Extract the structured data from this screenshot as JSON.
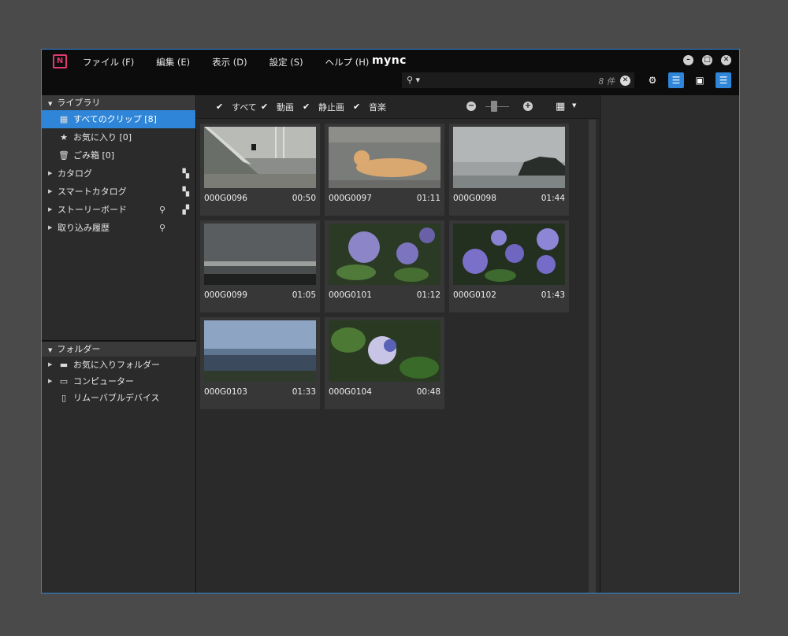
{
  "app": {
    "logo_text": "N",
    "brand": "mync",
    "menu": [
      "ファイル (F)",
      "編集 (E)",
      "表示 (D)",
      "設定 (S)",
      "ヘルプ (H)"
    ]
  },
  "search": {
    "count": "8 件",
    "value": ""
  },
  "library": {
    "header": "ライブラリ",
    "items": [
      {
        "label": "すべてのクリップ [8]",
        "icon": "clips-icon",
        "selected": true
      },
      {
        "label": "お気に入り [0]",
        "icon": "star-icon"
      },
      {
        "label": "ごみ箱 [0]",
        "icon": "trash-icon"
      }
    ],
    "groups": [
      {
        "label": "カタログ"
      },
      {
        "label": "スマートカタログ"
      },
      {
        "label": "ストーリーボード"
      },
      {
        "label": "取り込み履歴"
      }
    ]
  },
  "folders": {
    "header": "フォルダー",
    "items": [
      {
        "label": "お気に入りフォルダー",
        "icon": "folder-icon"
      },
      {
        "label": "コンピューター",
        "icon": "computer-icon"
      },
      {
        "label": "リムーバブルデバイス",
        "icon": "removable-device-icon"
      }
    ]
  },
  "filters": [
    "すべて",
    "動画",
    "静止画",
    "音楽"
  ],
  "clips": [
    {
      "name": "000G0096",
      "duration": "00:50"
    },
    {
      "name": "000G0097",
      "duration": "01:11"
    },
    {
      "name": "000G0098",
      "duration": "01:44"
    },
    {
      "name": "000G0099",
      "duration": "01:05"
    },
    {
      "name": "000G0101",
      "duration": "01:12"
    },
    {
      "name": "000G0102",
      "duration": "01:43"
    },
    {
      "name": "000G0103",
      "duration": "01:33"
    },
    {
      "name": "000G0104",
      "duration": "00:48"
    }
  ],
  "colors": {
    "accent": "#2f86d8",
    "logo": "#e03a6e"
  }
}
